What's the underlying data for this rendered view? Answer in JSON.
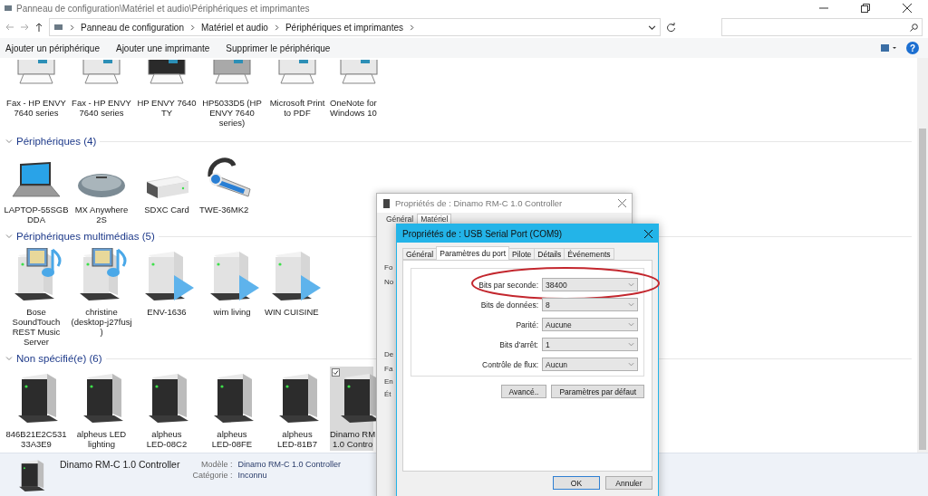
{
  "window": {
    "title": "Panneau de configuration\\Matériel et audio\\Périphériques et imprimantes"
  },
  "address": {
    "breadcrumbs": [
      "Panneau de configuration",
      "Matériel et audio",
      "Périphériques et imprimantes"
    ]
  },
  "commands": [
    "Ajouter un périphérique",
    "Ajouter une imprimante",
    "Supprimer le périphérique"
  ],
  "help": "?",
  "groups": [
    {
      "items": [
        {
          "kind": "printer",
          "lines": [
            "Fax - HP ENVY",
            "7640 series"
          ],
          "selected": false
        },
        {
          "kind": "printer",
          "lines": [
            "Fax - HP ENVY",
            "7640 series"
          ],
          "selected": false
        },
        {
          "kind": "inkjet_black",
          "lines": [
            "HP ENVY 7640",
            "TY"
          ],
          "selected": false
        },
        {
          "kind": "inkjet_grey",
          "lines": [
            "HP5033D5 (HP",
            "ENVY 7640",
            "series)"
          ],
          "selected": false
        },
        {
          "kind": "printer",
          "lines": [
            "Microsoft Print",
            "to PDF"
          ],
          "selected": false
        },
        {
          "kind": "printer",
          "lines": [
            "OneNote for",
            "Windows 10"
          ],
          "selected": false
        }
      ]
    },
    {
      "header": "Périphériques (4)",
      "items": [
        {
          "kind": "laptop",
          "lines": [
            "LAPTOP-55SGB",
            "DDA"
          ],
          "selected": false
        },
        {
          "kind": "mouse",
          "lines": [
            "MX Anywhere",
            "2S"
          ],
          "selected": false
        },
        {
          "kind": "card_reader",
          "lines": [
            "SDXC Card"
          ],
          "selected": false
        },
        {
          "kind": "headset",
          "lines": [
            "TWE-36MK2"
          ],
          "selected": false
        }
      ]
    },
    {
      "header": "Périphériques multimédias (5)",
      "items": [
        {
          "kind": "media_server",
          "lines": [
            "Bose",
            "SoundTouch",
            "REST Music",
            "Server"
          ],
          "selected": false
        },
        {
          "kind": "media_server",
          "lines": [
            "christine",
            "(desktop-j27fusj",
            ")"
          ],
          "selected": false
        },
        {
          "kind": "media_renderer",
          "lines": [
            "ENV-1636"
          ],
          "selected": false
        },
        {
          "kind": "media_renderer",
          "lines": [
            "wim living"
          ],
          "selected": false
        },
        {
          "kind": "media_renderer",
          "lines": [
            "WIN CUISINE"
          ],
          "selected": false
        }
      ]
    },
    {
      "header": "Non spécifié(e) (6)",
      "items": [
        {
          "kind": "server",
          "lines": [
            "846B21E2C531",
            "33A3E9"
          ],
          "selected": false
        },
        {
          "kind": "server",
          "lines": [
            "alpheus LED",
            "lighting"
          ],
          "selected": false
        },
        {
          "kind": "server",
          "lines": [
            "alpheus",
            "LED-08C2"
          ],
          "selected": false
        },
        {
          "kind": "server",
          "lines": [
            "alpheus",
            "LED-08FE"
          ],
          "selected": false
        },
        {
          "kind": "server",
          "lines": [
            "alpheus",
            "LED-81B7"
          ],
          "selected": false
        },
        {
          "kind": "server",
          "lines": [
            "Dinamo RM",
            "1.0 Contro"
          ],
          "selected": true,
          "checked": true
        }
      ]
    }
  ],
  "details": {
    "name": "Dinamo RM-C 1.0 Controller",
    "fields": [
      {
        "label": "Modèle :",
        "value": "Dinamo RM-C 1.0 Controller"
      },
      {
        "label": "Catégorie :",
        "value": "Inconnu"
      }
    ]
  },
  "back_dialog": {
    "title": "Propriétés de : Dinamo RM-C 1.0 Controller",
    "tabs": [
      {
        "label": "Général",
        "selected": false
      },
      {
        "label": "Matériel",
        "selected": true
      }
    ],
    "fragments": [
      "Fo",
      "No",
      "De",
      "Fa",
      "En",
      "Ét"
    ]
  },
  "port_dialog": {
    "title": "Propriétés de : USB Serial Port (COM9)",
    "tabs": [
      {
        "label": "Général",
        "selected": false
      },
      {
        "label": "Paramètres du port",
        "selected": true
      },
      {
        "label": "Pilote",
        "selected": false
      },
      {
        "label": "Détails",
        "selected": false
      },
      {
        "label": "Événements",
        "selected": false
      }
    ],
    "settings": [
      {
        "label": "Bits par seconde:",
        "value": "38400",
        "highlighted": true
      },
      {
        "label": "Bits de données:",
        "value": "8",
        "highlighted": false
      },
      {
        "label": "Parité:",
        "value": "Aucune",
        "highlighted": false
      },
      {
        "label": "Bits d'arrêt:",
        "value": "1",
        "highlighted": false
      },
      {
        "label": "Contrôle de flux:",
        "value": "Aucun",
        "highlighted": false
      }
    ],
    "buttons": [
      "Avancé..",
      "Paramètres par défaut"
    ],
    "footer_buttons": [
      {
        "label": "OK",
        "default": true
      },
      {
        "label": "Annuler",
        "default": false
      }
    ]
  }
}
